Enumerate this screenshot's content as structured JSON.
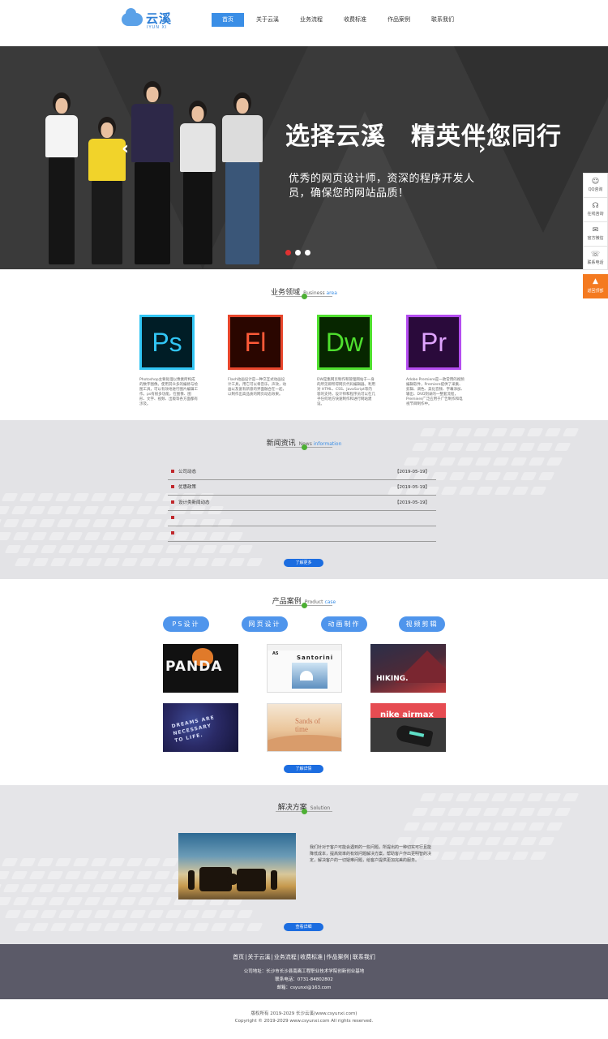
{
  "header": {
    "logo_text": "云溪",
    "logo_sub": "IYUN XI",
    "nav": [
      "首页",
      "关于云溪",
      "业务流程",
      "收费标准",
      "作品案例",
      "联系我们"
    ]
  },
  "banner": {
    "title": "选择云溪　精英伴您同行",
    "subtitle": "优秀的网页设计师，资深的程序开发人员，确保您的网站品质！",
    "prev": "‹",
    "next": "›",
    "slides": 3,
    "active_slide": 1
  },
  "sidebar": {
    "items": [
      {
        "icon": "qq-icon",
        "glyph": "☺",
        "label": "QQ咨询"
      },
      {
        "icon": "headset-icon",
        "glyph": "☊",
        "label": "在线咨询"
      },
      {
        "icon": "wechat-icon",
        "glyph": "✉",
        "label": "官方微信"
      },
      {
        "icon": "phone-icon",
        "glyph": "☏",
        "label": "联系电话"
      }
    ],
    "top": {
      "icon": "arrow-up-icon",
      "glyph": "▲",
      "label": "返回顶部"
    }
  },
  "business": {
    "title_cn": "业务领域",
    "title_en_a": "Business",
    "title_en_b": "area",
    "items": [
      {
        "abbr": "Ps",
        "color": "#31c5f4",
        "text_color": "#31c5f4",
        "bg": "#001d26",
        "desc": "Photoshop主要处理以像素所构成的数字图像。使用其众多的编修与绘图工具，可以有效地进行图片编辑工作。ps有很多功能，在图像、图形、文字、视频、出版等各方面都有涉及。"
      },
      {
        "abbr": "Fl",
        "color": "#e8462c",
        "text_color": "#ff5a38",
        "bg": "#2a0600",
        "desc": "Flash动画设计是一种交互式动画设计工具，用它可以将音乐，声效，动画以及富有新意的界面融合在一起，以制作出高品质的网页动态效果。"
      },
      {
        "abbr": "Dw",
        "color": "#4fe02e",
        "text_color": "#4fe02e",
        "bg": "#072600",
        "desc": "DW是集网页制作和管理网站于一身的所见即所得网页代码编辑器。利用对 HTML、CSS、JavaScript等内容的支持，设计师和程序员可以在几乎任何地方快速制作和进行网站建设。"
      },
      {
        "abbr": "Pr",
        "color": "#b44cf0",
        "text_color": "#e0a4ff",
        "bg": "#2a0a3b",
        "desc": "Adobe Premiere是一款常用的视频编辑软件，Premiere提供了采集、剪辑、调色、美化音频、字幕添加、输出、DVD刻录的一整套流程，Premiere广泛应用于广告制作和电视节目制作中。"
      }
    ]
  },
  "news": {
    "title_cn": "新闻资讯",
    "title_en_a": "News",
    "title_en_b": "information",
    "rows": [
      {
        "title": "公司动态",
        "date": "【2019-05-19】"
      },
      {
        "title": "优惠政策",
        "date": "【2019-05-19】"
      },
      {
        "title": "设计类新闻动态",
        "date": "【2019-05-19】"
      },
      {
        "title": "",
        "date": ""
      },
      {
        "title": "",
        "date": ""
      }
    ],
    "more": "了解更多"
  },
  "products": {
    "title_cn": "产品案例",
    "title_en_a": "Product",
    "title_en_b": "case",
    "tabs": [
      "PS设计",
      "网页设计",
      "动画制作",
      "视频剪辑"
    ],
    "cases": [
      "PANDA",
      "Santorini",
      "HIKING.",
      "DREAMS ARE NECESSARY TO LIFE.",
      "Sands of time",
      "nike airmax"
    ],
    "more": "了解详情"
  },
  "solution": {
    "title_cn": "解决方案",
    "title_en": "Solution",
    "text": "我们针对于客户可能会遇到的一些问题，所提出的一种切实可行且能降低成本，提高效率的有效问题解决方案，帮助客户作出更明智的决定，解决客户的一切疑难问题，给客户提供更加完美的服务。",
    "more": "查看详细"
  },
  "footer": {
    "nav": [
      "首页",
      "关于云溪",
      "业务流程",
      "收费标准",
      "作品案例",
      "联系我们"
    ],
    "address": "公司地址：长沙市长沙县南离工程职业技术学院创新创业基地",
    "phone": "联系电话：0731-84802802",
    "email": "邮箱：csyunxi@163.com",
    "copyright_cn": "版权所有 2019-2029 长沙云溪(www.csyunxi.com)",
    "copyright_en": "Copyright © 2019-2029 www.csyunxi.com All rights reserved."
  }
}
